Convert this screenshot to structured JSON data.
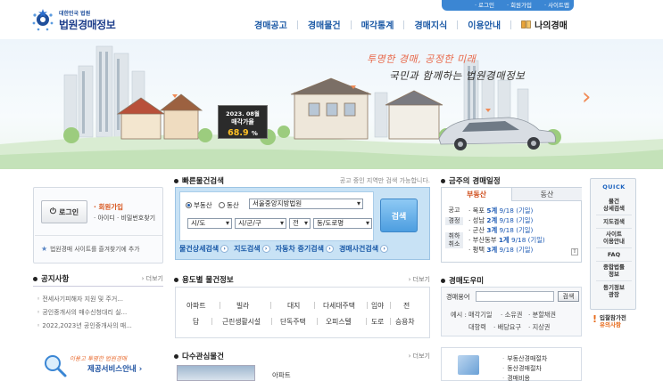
{
  "header": {
    "logo_sub": "대한민국 법원",
    "logo_main": "법원경매정보",
    "top_links": [
      "로그인",
      "회원가입",
      "사이트맵"
    ],
    "gnb": [
      "경매공고",
      "경매물건",
      "매각통계",
      "경매지식",
      "이용안내"
    ],
    "my_auction": "나의경매"
  },
  "hero": {
    "slogan1": "투명한 경매, 공정한 미래",
    "slogan2": "국민과 함께하는 법원경매정보",
    "badge_line1": "2023. 08월",
    "badge_line2": "매각가율",
    "badge_value": "68.9",
    "badge_unit": "%"
  },
  "login": {
    "button": "로그인",
    "join": "회원가입",
    "find": "아이디 · 비밀번호찾기",
    "favorite": "법원경매 사이트를 즐겨찾기에 추가"
  },
  "notice": {
    "title": "공지사항",
    "more": "더보기",
    "items": [
      "전세사기피해자 지원 및 주거...",
      "공인중개사의 매수신청대리 실...",
      "2022,2023년 공인중개사의 매..."
    ]
  },
  "banner": {
    "top": "이용고 투명한 법원경매",
    "main": "제공서비스안내"
  },
  "quick_search": {
    "title": "빠른물건검색",
    "note": "공고 중인 지역만 검색 가능합니다.",
    "radio_realestate": "부동산",
    "radio_movable": "동산",
    "court_value": "서울중앙지방법원",
    "sido": "시/도",
    "sigungu": "시/군/구",
    "all": "전",
    "dong": "동/도로명",
    "search_btn": "검색",
    "links": [
      "물건상세검색",
      "지도검색",
      "자동차 중기검색",
      "경매사건검색"
    ]
  },
  "category": {
    "title": "용도별 물건정보",
    "more": "더보기",
    "row1": [
      "아파트",
      "빌라",
      "대지",
      "다세대주택",
      "임야",
      "전"
    ],
    "row2": [
      "답",
      "근린생활시설",
      "단독주택",
      "오피스텔",
      "도로",
      "승용차"
    ]
  },
  "interest": {
    "title": "다수관심물건",
    "more": "더보기",
    "text": "아파트"
  },
  "schedule": {
    "title": "금주의 경매일정",
    "tab_active": "부동산",
    "tab_inactive": "동산",
    "side": [
      "공고",
      "경정",
      "취하",
      "취소"
    ],
    "rows": [
      {
        "place": "목포",
        "count": "5계",
        "date": "9/18 (기일)"
      },
      {
        "place": "성남",
        "count": "2계",
        "date": "9/18 (기일)"
      },
      {
        "place": "군산",
        "count": "3계",
        "date": "9/18 (기일)"
      },
      {
        "place": "부산동부",
        "count": "1계",
        "date": "9/18 (기일)"
      },
      {
        "place": "평택",
        "count": "3계",
        "date": "9/18 (기일)"
      }
    ]
  },
  "helper": {
    "title": "경매도우미",
    "label": "경매용어",
    "btn": "검색",
    "example_label": "예시 :",
    "examples": [
      "매각기일",
      "소유권",
      "분할채권",
      "대항력",
      "배당요구",
      "지상권"
    ]
  },
  "process": {
    "items": [
      "부동산경매절차",
      "동산경매절차",
      "경매비용"
    ]
  },
  "quick_menu": {
    "title": "QUICK",
    "items": [
      "물건\n상세검색",
      "지도검색",
      "사이트\n이용안내",
      "FAQ",
      "종합법률\n정보",
      "등기정보\n광장"
    ],
    "extra1": "입찰참가전",
    "extra2": "유의사항"
  }
}
